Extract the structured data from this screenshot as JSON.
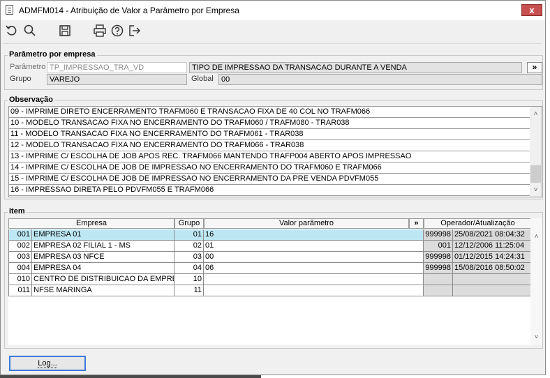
{
  "window": {
    "title": "ADMFM014 - Atribuição de Valor a Parâmetro por Empresa",
    "close_label": "x"
  },
  "toolbar": {
    "icons": [
      "undo-icon",
      "search-icon",
      "save-icon",
      "print-icon",
      "help-icon",
      "exit-icon"
    ]
  },
  "param": {
    "legend": "Parâmetro por empresa",
    "param_label": "Parâmetro",
    "param_value": "TP_IMPRESSAO_TRA_VD",
    "param_desc": "TIPO DE IMPRESSAO DA TRANSACAO DURANTE A VENDA",
    "more_label": "»",
    "group_label": "Grupo",
    "group_value": "VAREJO",
    "global_label": "Global",
    "global_value": "00"
  },
  "obs": {
    "legend": "Observação",
    "lines": [
      "09 - IMPRIME DIRETO ENCERRAMENTO TRAFM060 E TRANSACAO FIXA DE 40 COL NO TRAFM066",
      "10 - MODELO TRANSACAO FIXA NO ENCERRAMENTO DO TRAFM060 / TRAFM080 - TRAR038",
      "11 - MODELO TRANSACAO FIXA NO ENCERRAMENTO DO TRAFM061 - TRAR038",
      "12 - MODELO TRANSACAO FIXA NO ENCERRAMENTO DO TRAFM066 - TRAR038",
      "13 - IMPRIME C/ ESCOLHA DE JOB APOS REC. TRAFM066 MANTENDO TRAFP004 ABERTO APOS IMPRESSAO",
      "14 - IMPRIME C/ ESCOLHA DE JOB DE IMPRESSAO NO ENCERRAMENTO DO TRAFM060 E TRAFM066",
      "15 - IMPRIME C/ ESCOLHA DE JOB DE IMPRESSAO NO ENCERRAMENTO DA PRE VENDA PDVFM055",
      "16 - IMPRESSAO DIRETA PELO PDVFM055 E TRAFM066"
    ]
  },
  "item": {
    "legend": "Item",
    "headers": {
      "empresa": "Empresa",
      "grupo": "Grupo",
      "valor": "Valor parâmetro",
      "more": "»",
      "operador": "Operador/Atualização"
    },
    "rows": [
      {
        "code": "001",
        "name": "EMPRESA 01",
        "grupo": "01",
        "valor": "16",
        "operador": "999998",
        "data": "25/08/2021 08:04:32"
      },
      {
        "code": "002",
        "name": "EMPRESA 02 FILIAL 1 - MS",
        "grupo": "02",
        "valor": "01",
        "operador": "001",
        "data": "12/12/2006 11:25:04"
      },
      {
        "code": "003",
        "name": "EMPRESA 03 NFCE",
        "grupo": "03",
        "valor": "00",
        "operador": "999998",
        "data": "01/12/2015 14:24:31"
      },
      {
        "code": "004",
        "name": "EMPRESA 04",
        "grupo": "04",
        "valor": "06",
        "operador": "999998",
        "data": "15/08/2016 08:50:02"
      },
      {
        "code": "010",
        "name": "CENTRO DE DISTRIBUICAO DA EMPRESA",
        "grupo": "10",
        "valor": "",
        "operador": "",
        "data": ""
      },
      {
        "code": "011",
        "name": "NFSE MARINGA",
        "grupo": "11",
        "valor": "",
        "operador": "",
        "data": ""
      }
    ]
  },
  "footer": {
    "log_label": "Log..."
  }
}
